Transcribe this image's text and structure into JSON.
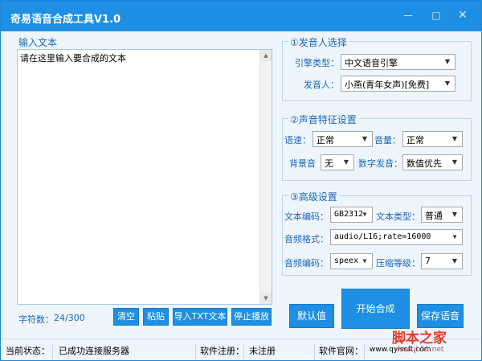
{
  "window": {
    "title": "奇易语音合成工具V1.0",
    "minimize_icon": "minimize-icon",
    "maximize_icon": "maximize-icon",
    "close_icon": "close-icon"
  },
  "input": {
    "title": "输入文本",
    "placeholder_text": "请在这里输入要合成的文本",
    "char_count_label": "字符数：",
    "char_count": "24/300"
  },
  "buttons": {
    "clear": "清空",
    "paste": "粘贴",
    "import_txt": "导入TXT文本",
    "stop_play": "停止播放",
    "default": "默认值",
    "start": "开始合成",
    "save": "保存语音"
  },
  "speaker": {
    "title": "①发音人选择",
    "engine_label": "引擎类型：",
    "engine_value": "中文语音引擎",
    "voice_label": "发音人：",
    "voice_value": "小燕(青年女声)[免费]"
  },
  "features": {
    "title": "②声音特征设置",
    "speed_label": "语速：",
    "speed_value": "正常",
    "volume_label": "音量：",
    "volume_value": "正常",
    "bg_label": "背景音",
    "bg_value": "无",
    "digit_label": "数字发音：",
    "digit_value": "数值优先"
  },
  "advanced": {
    "title": "③高级设置",
    "encoding_label": "文本编码：",
    "encoding_value": "GB2312",
    "type_label": "文本类型：",
    "type_value": "普通",
    "format_label": "音频格式：",
    "format_value": "audio/L16;rate=16000",
    "codec_label": "音频编码：",
    "codec_value": "speex",
    "level_label": "压缩等级：",
    "level_value": "7"
  },
  "status": {
    "state_label": "当前状态：",
    "state_value": "已成功连接服务器",
    "reg_label": "软件注册：",
    "reg_value": "未注册",
    "site_label": "软件官网：",
    "site_value": "www.qyisoft.com"
  },
  "watermark": {
    "text": "脚本之家",
    "url": "www.jb51.net"
  },
  "colors": {
    "accent": "#1e8fe3",
    "label": "#1b66b8",
    "panel_bg": "#eef5fc"
  }
}
